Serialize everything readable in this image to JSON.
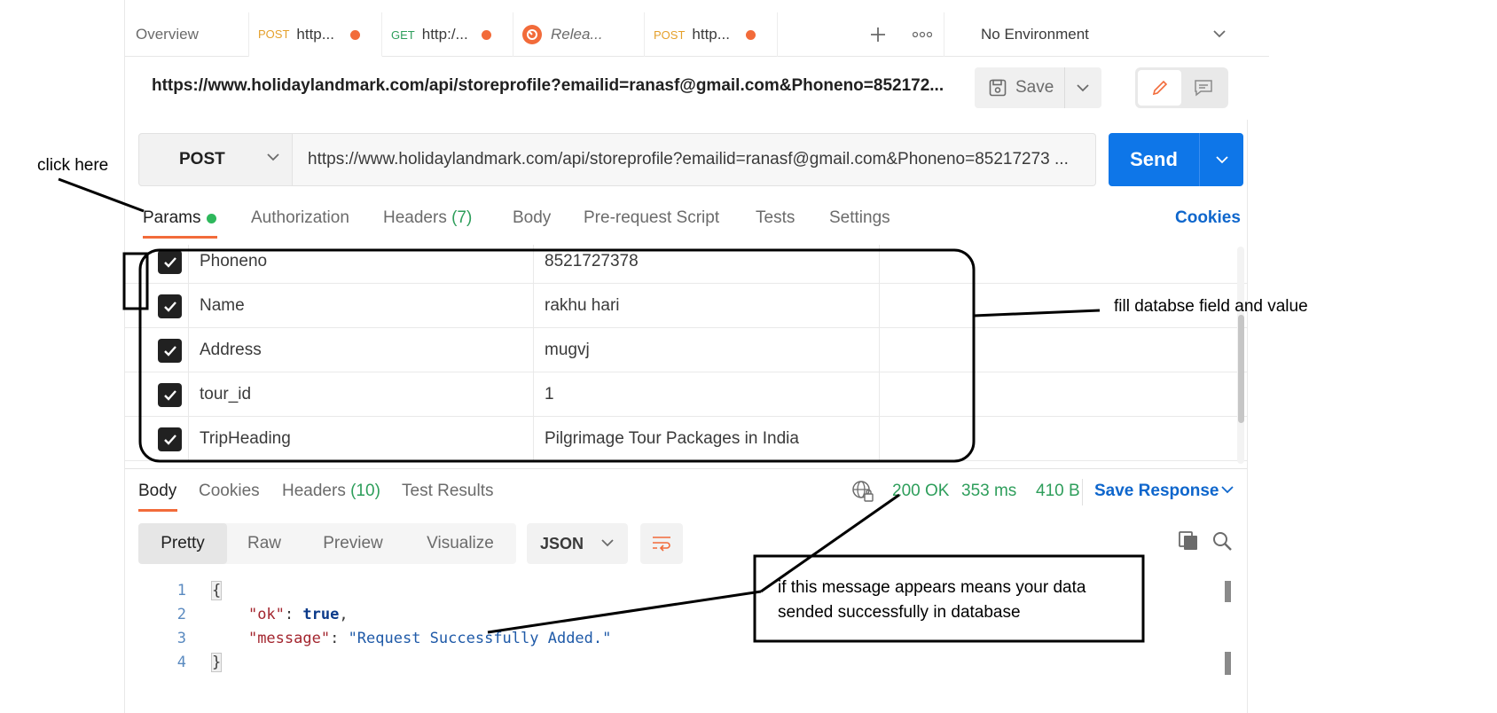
{
  "tabs": [
    {
      "method": "",
      "title": "Overview"
    },
    {
      "method": "POST",
      "title": "http..."
    },
    {
      "method": "GET",
      "title": "http:/..."
    },
    {
      "method": "",
      "title": "Relea..."
    },
    {
      "method": "POST",
      "title": "http..."
    }
  ],
  "environment": "No Environment",
  "request": {
    "title_url": "https://www.holidaylandmark.com/api/storeprofile?emailid=ranasf@gmail.com&Phoneno=852172...",
    "method": "POST",
    "url": "https://www.holidaylandmark.com/api/storeprofile?emailid=ranasf@gmail.com&Phoneno=85217273 ...",
    "save_label": "Save",
    "send_label": "Send"
  },
  "request_tabs": {
    "params": "Params",
    "authorization": "Authorization",
    "headers": "Headers",
    "headers_count": "(7)",
    "body": "Body",
    "prerequest": "Pre-request Script",
    "tests": "Tests",
    "settings": "Settings",
    "cookies": "Cookies"
  },
  "params": [
    {
      "key": "Phoneno",
      "value": "8521727378"
    },
    {
      "key": "Name",
      "value": "rakhu hari"
    },
    {
      "key": "Address",
      "value": "mugvj"
    },
    {
      "key": "tour_id",
      "value": "1"
    },
    {
      "key": "TripHeading",
      "value": "Pilgrimage Tour Packages in India"
    }
  ],
  "response_tabs": {
    "body": "Body",
    "cookies": "Cookies",
    "headers": "Headers",
    "headers_count": "(10)",
    "test_results": "Test Results"
  },
  "response_status": {
    "status": "200 OK",
    "time": "353 ms",
    "size": "410 B",
    "save_response": "Save Response"
  },
  "format_tabs": [
    "Pretty",
    "Raw",
    "Preview",
    "Visualize"
  ],
  "format_select": "JSON",
  "code": {
    "line_numbers": [
      "1",
      "2",
      "3",
      "4"
    ],
    "open_brace": "{",
    "close_brace": "}",
    "ok_key": "\"ok\"",
    "ok_value": "true",
    "message_key": "\"message\"",
    "message_value": "\"Request Successfully Added.\""
  },
  "annotations": {
    "click_here": "click  here",
    "fill_fields": "fill databse  field and value",
    "success_line1": "if this message appears means your data",
    "success_line2": "sended successfully in database"
  },
  "colors": {
    "accent": "#f26b3a",
    "send_button": "#0e76e8",
    "status_ok": "#2e9e5b",
    "link": "#0e66cc"
  }
}
